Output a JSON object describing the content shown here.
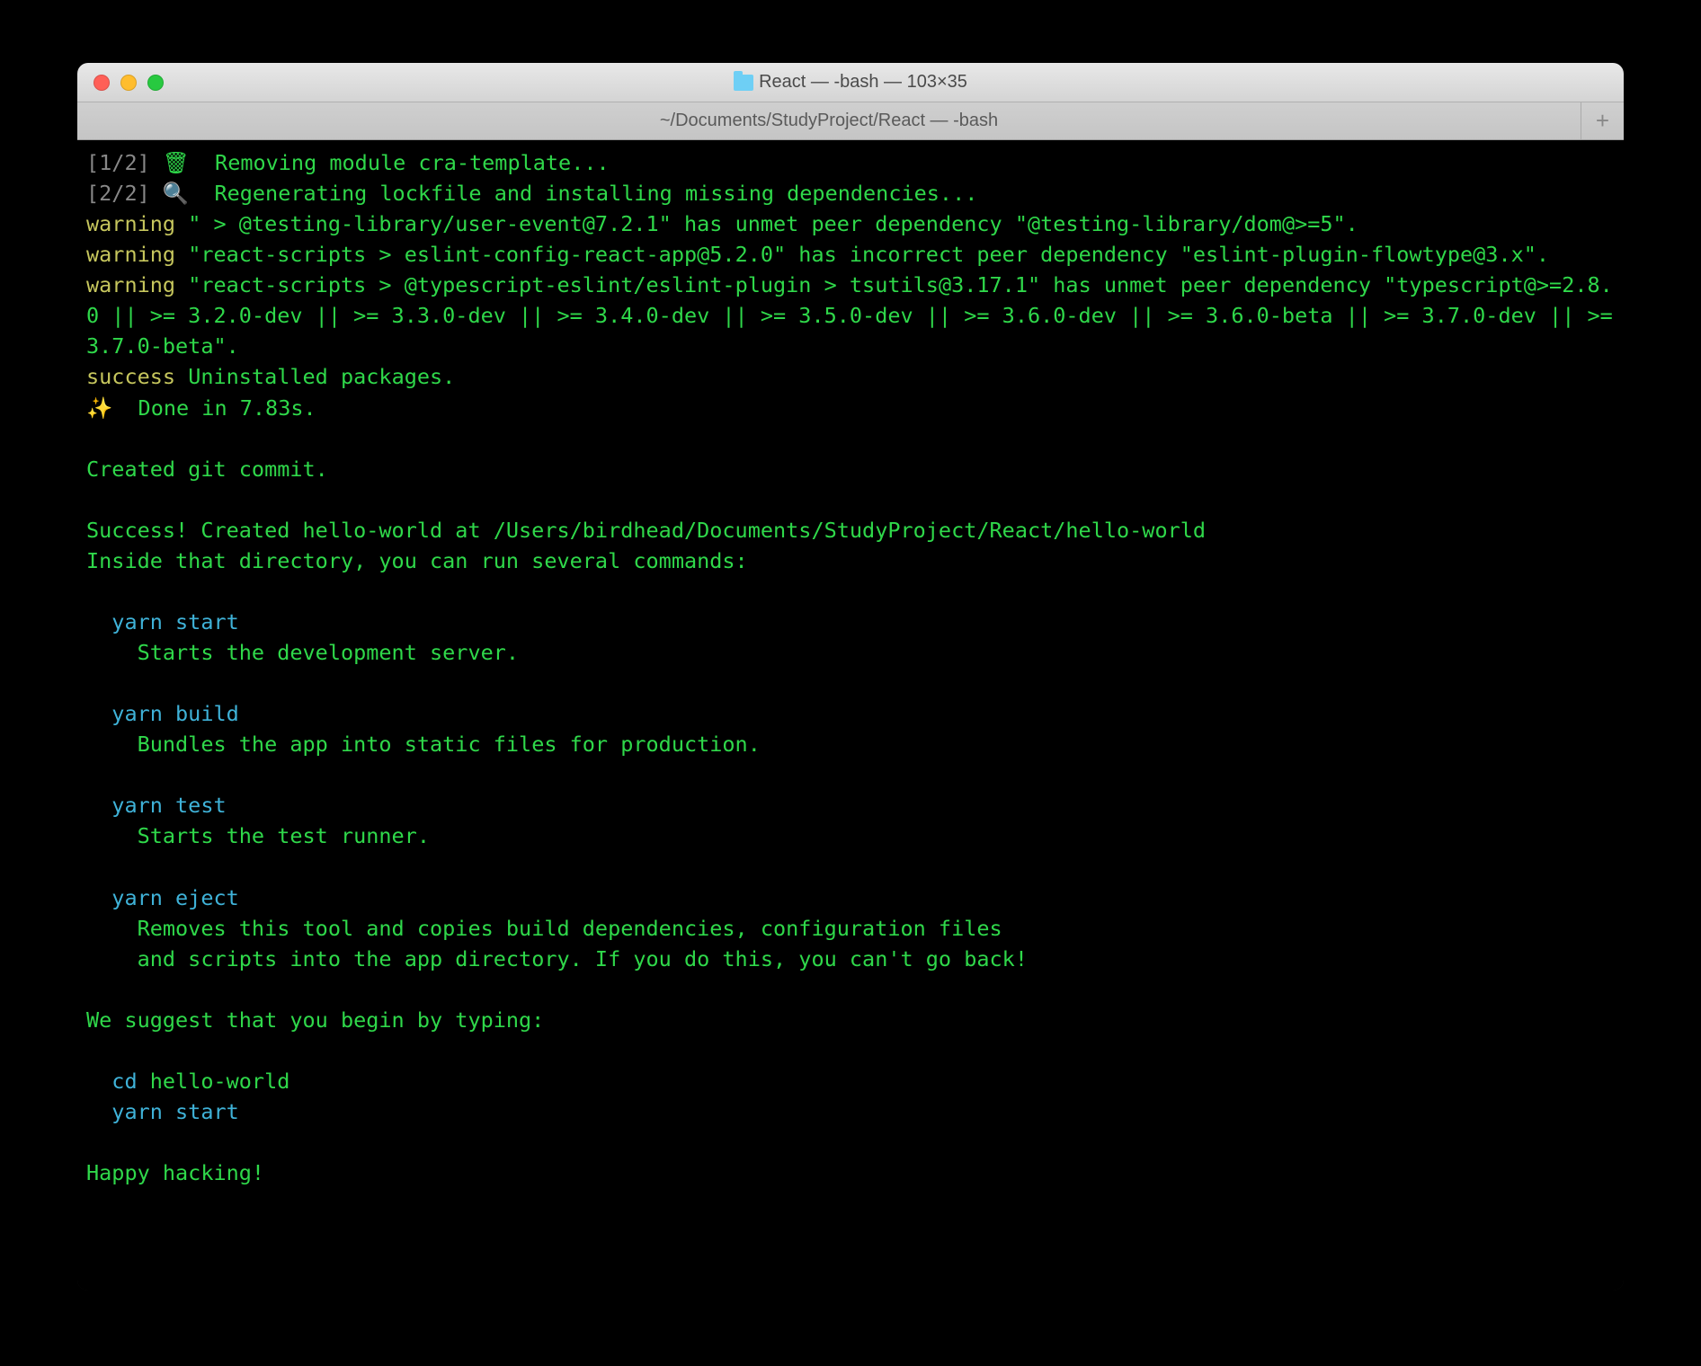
{
  "window": {
    "title": "React — -bash — 103×35",
    "tab": "~/Documents/StudyProject/React — -bash"
  },
  "terminal": {
    "step1_label": "[1/2]",
    "step1_icon": "🗑",
    "step1_text": "Removing module cra-template...",
    "step2_label": "[2/2]",
    "step2_icon": "🔍",
    "step2_text": "Regenerating lockfile and installing missing dependencies...",
    "warn_label": "warning",
    "warn1": " \" > @testing-library/user-event@7.2.1\" has unmet peer dependency \"@testing-library/dom@>=5\".",
    "warn2": " \"react-scripts > eslint-config-react-app@5.2.0\" has incorrect peer dependency \"eslint-plugin-flowtype@3.x\".",
    "warn3": " \"react-scripts > @typescript-eslint/eslint-plugin > tsutils@3.17.1\" has unmet peer dependency \"typescript@>=2.8.0 || >= 3.2.0-dev || >= 3.3.0-dev || >= 3.4.0-dev || >= 3.5.0-dev || >= 3.6.0-dev || >= 3.6.0-beta || >= 3.7.0-dev || >= 3.7.0-beta\".",
    "success_label": "success",
    "success_text": " Uninstalled packages.",
    "done_icon": "✨",
    "done_text": "  Done in 7.83s.",
    "git_commit": "Created git commit.",
    "success_created": "Success! Created hello-world at /Users/birdhead/Documents/StudyProject/React/hello-world",
    "inside_dir": "Inside that directory, you can run several commands:",
    "cmd1": "yarn start",
    "cmd1_desc": "Starts the development server.",
    "cmd2": "yarn build",
    "cmd2_desc": "Bundles the app into static files for production.",
    "cmd3": "yarn test",
    "cmd3_desc": "Starts the test runner.",
    "cmd4": "yarn eject",
    "cmd4_desc1": "Removes this tool and copies build dependencies, configuration files",
    "cmd4_desc2": "and scripts into the app directory. If you do this, you can't go back!",
    "suggest": "We suggest that you begin by typing:",
    "cd_cmd": "cd ",
    "cd_arg": "hello-world",
    "start_cmd": "yarn start",
    "happy": "Happy hacking!"
  }
}
